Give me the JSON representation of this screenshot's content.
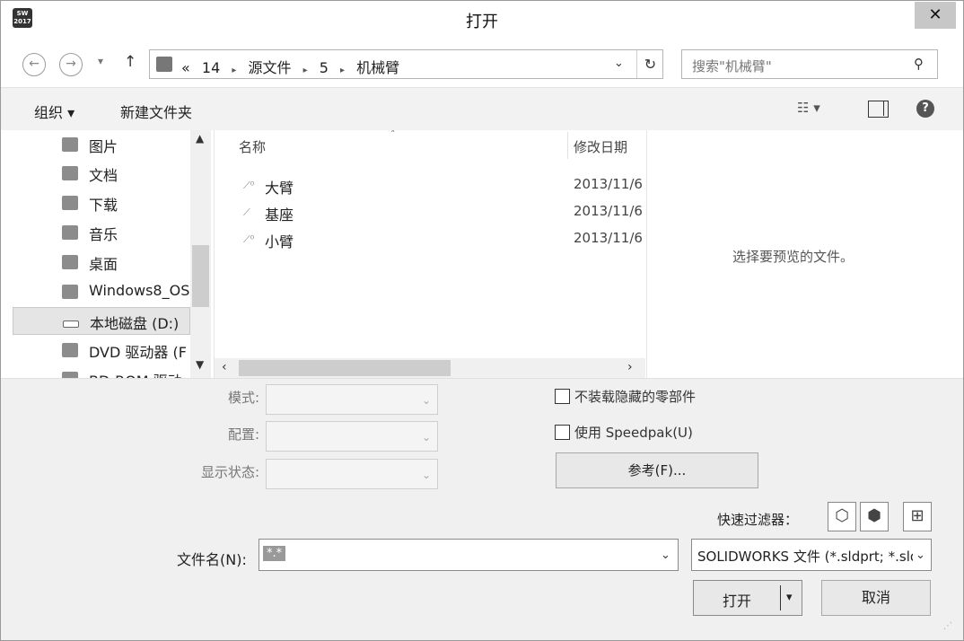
{
  "window": {
    "title": "打开",
    "app_icon_text": "SW 2017",
    "close_label": "✕"
  },
  "address": {
    "back_icon": "←",
    "forward_icon": "→",
    "up_icon": "↑",
    "overflow": "«",
    "crumbs": [
      "14",
      "源文件",
      "5",
      "机械臂"
    ],
    "separator": "▸",
    "dropdown_icon": "⌄",
    "refresh_icon": "↻"
  },
  "search": {
    "placeholder": "搜索\"机械臂\"",
    "icon": "⚲"
  },
  "toolbar": {
    "organize": "组织 ▾",
    "new_folder": "新建文件夹",
    "view_icon": "☷ ▾",
    "help_icon": "?"
  },
  "nav": {
    "items": [
      "图片",
      "文档",
      "下载",
      "音乐",
      "桌面",
      "Windows8_OS",
      "本地磁盘 (D:)",
      "DVD 驱动器 (F",
      "BD-ROM 驱动"
    ],
    "selected_index": 6
  },
  "filelist": {
    "columns": {
      "name": "名称",
      "date": "修改日期"
    },
    "files": [
      {
        "name": "大臂",
        "date": "2013/11/6"
      },
      {
        "name": "基座",
        "date": "2013/11/6"
      },
      {
        "name": "小臂",
        "date": "2013/11/6"
      }
    ]
  },
  "preview": {
    "text": "选择要预览的文件。"
  },
  "options": {
    "mode_label": "模式:",
    "config_label": "配置:",
    "display_state_label": "显示状态:",
    "no_hidden_label": "不装载隐藏的零部件",
    "speedpak_label": "使用 Speedpak(U)",
    "reference_button": "参考(F)...",
    "quick_filter_label": "快速过滤器："
  },
  "filename": {
    "label": "文件名(N):",
    "value": "*.*"
  },
  "filetype": {
    "value": "SOLIDWORKS 文件 (*.sldprt; *.sldasm; *.slddrw)"
  },
  "buttons": {
    "open": "打开",
    "open_arrow": "▾",
    "cancel": "取消"
  }
}
